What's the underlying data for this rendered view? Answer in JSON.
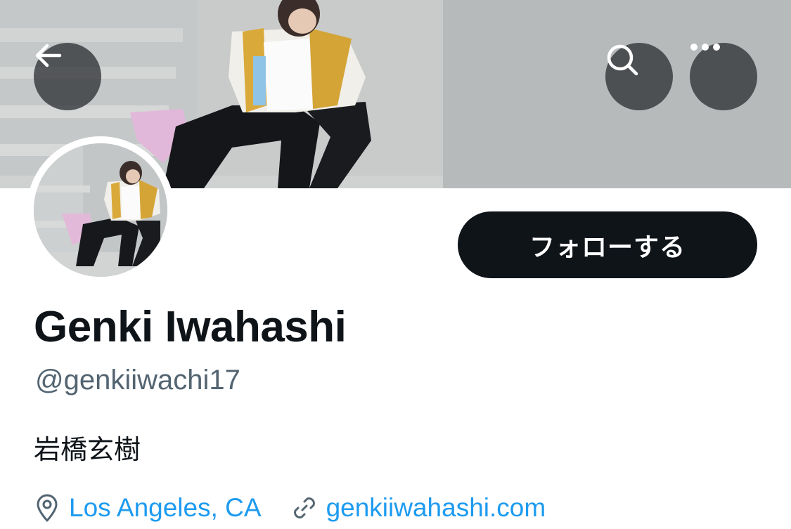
{
  "profile": {
    "display_name": "Genki Iwahashi",
    "handle": "@genkiiwachi17",
    "bio": "岩橋玄樹",
    "location": "Los Angeles, CA",
    "website": "genkiiwahashi.com"
  },
  "actions": {
    "follow_label": "フォローする"
  },
  "icons": {
    "back": "arrow-left-icon",
    "search": "search-icon",
    "more": "more-horizontal-icon",
    "location": "location-pin-icon",
    "link": "link-icon"
  },
  "colors": {
    "text_primary": "#0f1419",
    "text_secondary": "#536471",
    "link": "#1d9bf0",
    "follow_button_bg": "#0f1419",
    "follow_button_text": "#ffffff",
    "header_button_bg": "#303236"
  }
}
